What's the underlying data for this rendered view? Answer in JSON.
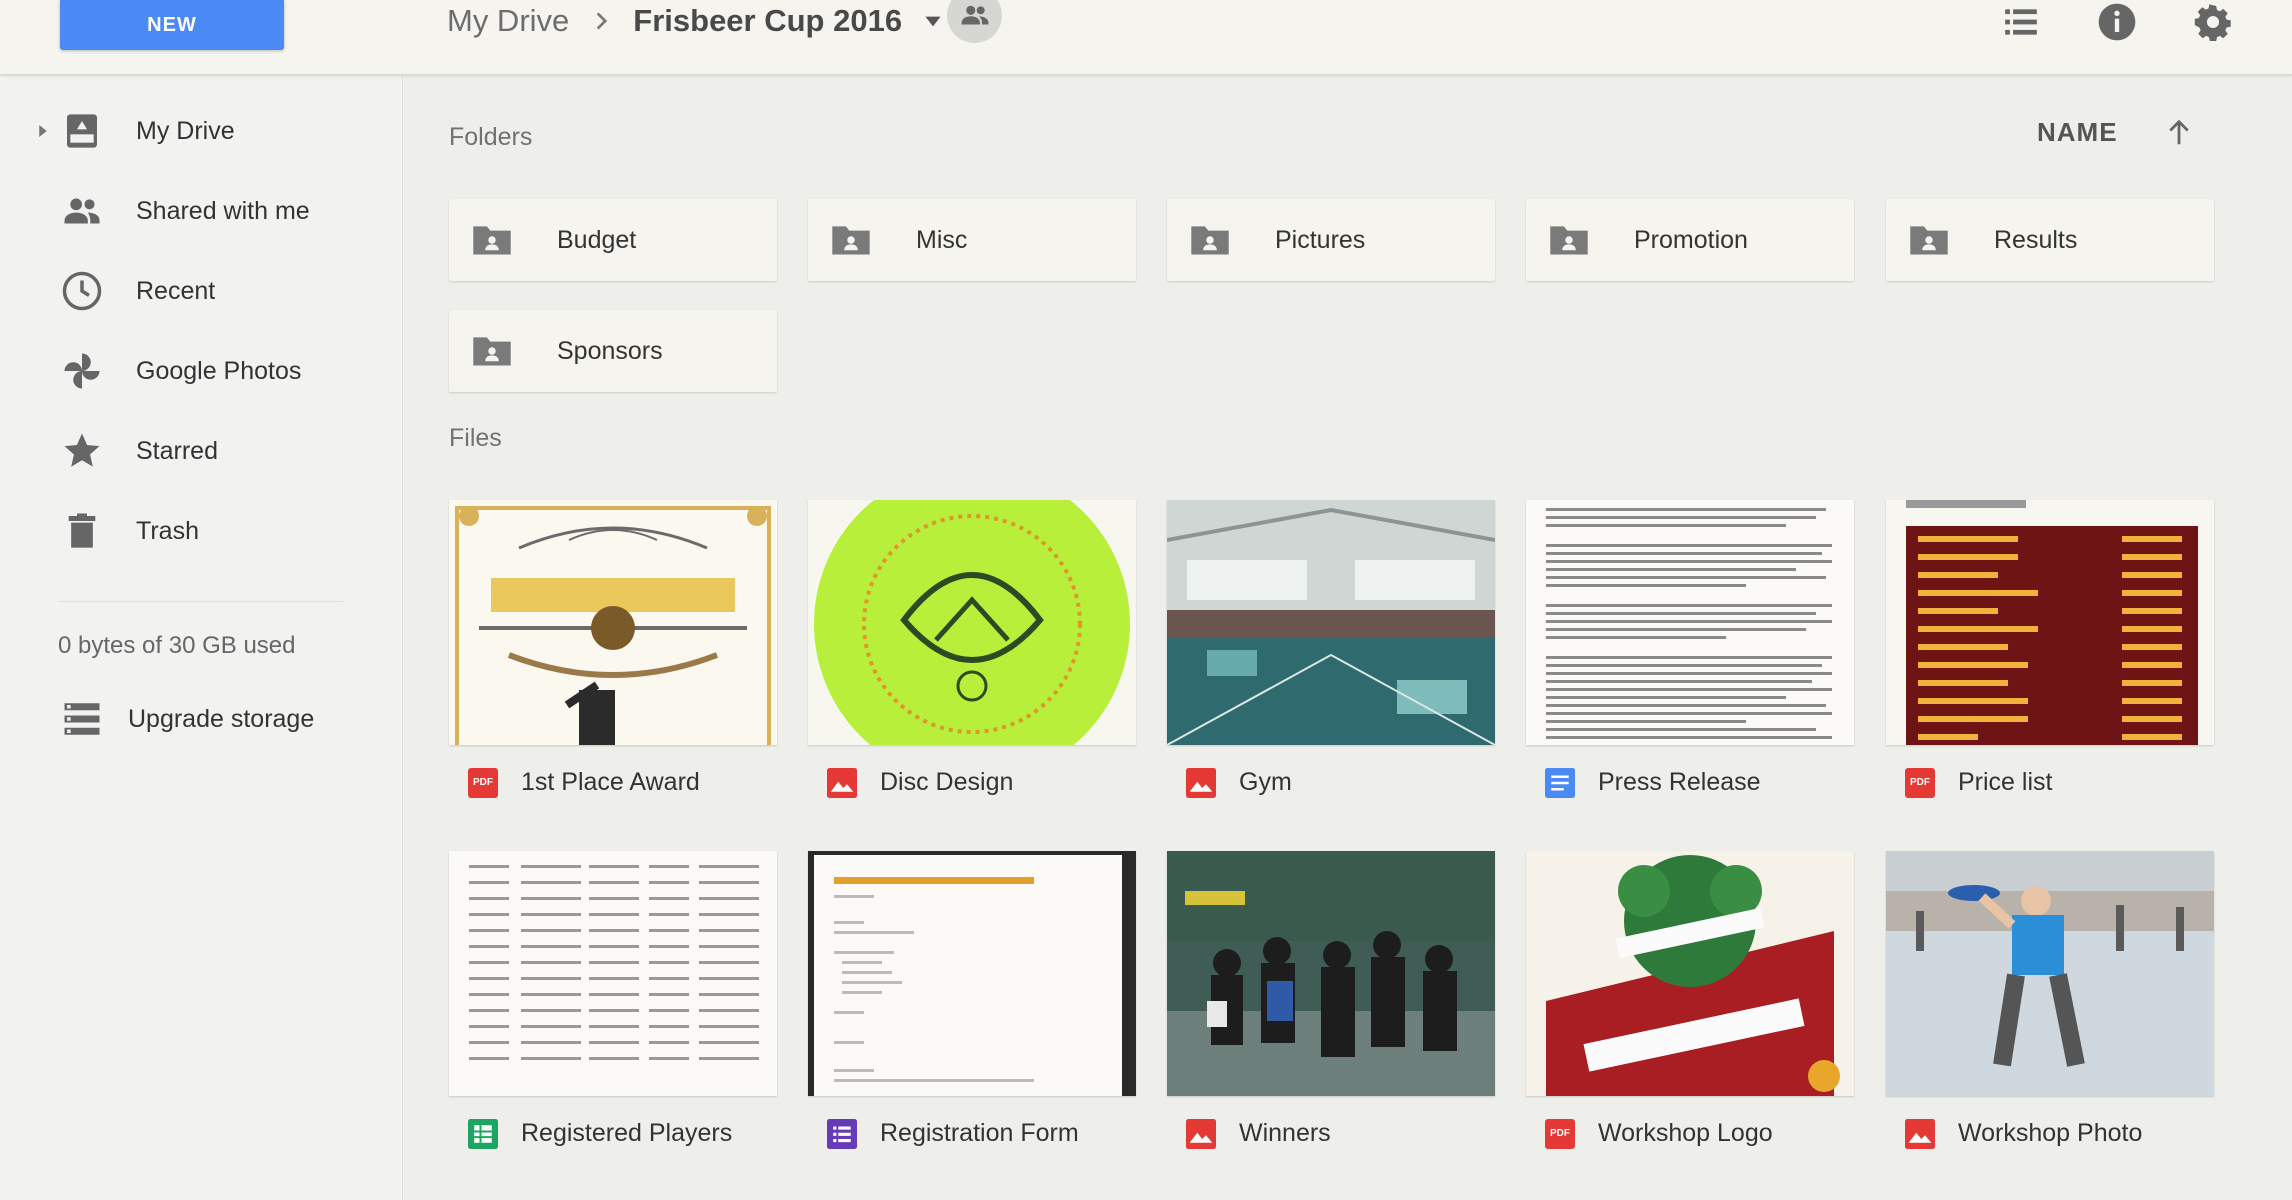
{
  "header": {
    "new_label": "NEW",
    "breadcrumb_root": "My Drive",
    "breadcrumb_current": "Frisbeer Cup 2016"
  },
  "sidebar": {
    "items": [
      {
        "label": "My Drive",
        "icon": "drive-icon"
      },
      {
        "label": "Shared with me",
        "icon": "people-icon"
      },
      {
        "label": "Recent",
        "icon": "clock-icon"
      },
      {
        "label": "Google Photos",
        "icon": "pinwheel-icon"
      },
      {
        "label": "Starred",
        "icon": "star-icon"
      },
      {
        "label": "Trash",
        "icon": "trash-icon"
      }
    ],
    "storage": "0 bytes of 30 GB used",
    "upgrade": "Upgrade storage"
  },
  "main": {
    "folders_label": "Folders",
    "files_label": "Files",
    "sort_label": "NAME",
    "folders": [
      {
        "name": "Budget"
      },
      {
        "name": "Misc"
      },
      {
        "name": "Pictures"
      },
      {
        "name": "Promotion"
      },
      {
        "name": "Results"
      },
      {
        "name": "Sponsors"
      }
    ],
    "files": [
      {
        "name": "1st Place Award",
        "type": "pdf"
      },
      {
        "name": "Disc Design",
        "type": "image"
      },
      {
        "name": "Gym",
        "type": "image"
      },
      {
        "name": "Press Release",
        "type": "doc"
      },
      {
        "name": "Price list",
        "type": "pdf"
      },
      {
        "name": "Registered Players",
        "type": "sheet"
      },
      {
        "name": "Registration Form",
        "type": "form"
      },
      {
        "name": "Winners",
        "type": "image"
      },
      {
        "name": "Workshop Logo",
        "type": "pdf"
      },
      {
        "name": "Workshop Photo",
        "type": "image"
      }
    ]
  },
  "colors": {
    "accent": "#4a8af4",
    "pdf": "#e53935",
    "image": "#e53935",
    "doc": "#4a8af4",
    "sheet": "#1fa463",
    "form": "#673ab7"
  }
}
